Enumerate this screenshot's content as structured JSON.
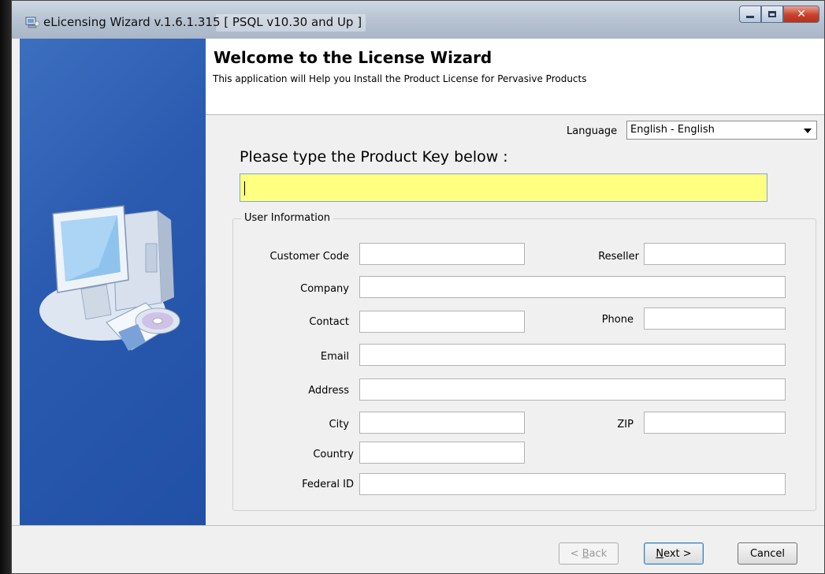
{
  "window": {
    "title": "eLicensing Wizard v.1.6.1.315  [ PSQL v10.30 and Up ]"
  },
  "header": {
    "heading": "Welcome to the License Wizard",
    "subtitle": "This application will Help you Install the Product License for Pervasive Products"
  },
  "language": {
    "label": "Language",
    "selected": "English - English"
  },
  "product_key": {
    "prompt": "Please type the Product Key below :",
    "value": ""
  },
  "user_info": {
    "legend": "User Information",
    "fields": {
      "customer_code": "Customer Code",
      "reseller": "Reseller",
      "company": "Company",
      "contact": "Contact",
      "phone": "Phone",
      "email": "Email",
      "address": "Address",
      "city": "City",
      "zip": "ZIP",
      "country": "Country",
      "federal_id": "Federal ID"
    }
  },
  "buttons": {
    "back_prefix": "< ",
    "back_key": "B",
    "back_rest": "ack",
    "next_key": "N",
    "next_rest": "ext >",
    "cancel": "Cancel"
  },
  "colors": {
    "side_panel": "#2a5bb0",
    "product_key_bg": "#ffff80"
  },
  "icons": {
    "app": "app-wizard-icon",
    "illustration": "computer-cd-illustration"
  }
}
